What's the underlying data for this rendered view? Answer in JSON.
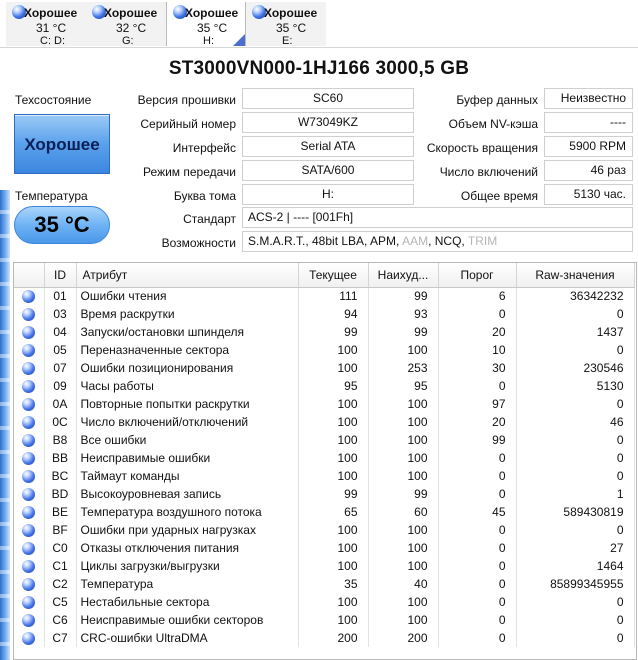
{
  "drives": [
    {
      "status": "Хорошее",
      "temp": "31 °C",
      "letters": "C: D:",
      "selected": false
    },
    {
      "status": "Хорошее",
      "temp": "32 °C",
      "letters": "G:",
      "selected": false
    },
    {
      "status": "Хорошее",
      "temp": "35 °C",
      "letters": "H:",
      "selected": true
    },
    {
      "status": "Хорошее",
      "temp": "35 °C",
      "letters": "E:",
      "selected": false
    }
  ],
  "model_title": "ST3000VN000-1HJ166  3000,5 GB",
  "health": {
    "label": "Техсостояние",
    "value": "Хорошее"
  },
  "temperature": {
    "label": "Температура",
    "value": "35 °C"
  },
  "info": {
    "firmware": {
      "label": "Версия прошивки",
      "value": "SC60"
    },
    "serial": {
      "label": "Серийный номер",
      "value": "W73049KZ"
    },
    "interface": {
      "label": "Интерфейс",
      "value": "Serial ATA"
    },
    "transfer": {
      "label": "Режим передачи",
      "value": "SATA/600"
    },
    "drive_letter": {
      "label": "Буква тома",
      "value": "H:"
    },
    "standard": {
      "label": "Стандарт",
      "value": "ACS-2 | ---- [001Fh]"
    },
    "features_label": "Возможности",
    "features_active": "S.M.A.R.T., 48bit LBA, APM, ",
    "features_aam": "AAM",
    "features_ncq": ", NCQ, ",
    "features_trim": "TRIM",
    "buffer": {
      "label": "Буфер данных",
      "value": "Неизвестно"
    },
    "nv_cache": {
      "label": "Объем NV-кэша",
      "value": "----"
    },
    "rotation": {
      "label": "Скорость вращения",
      "value": "5900 RPM"
    },
    "power_on_count": {
      "label": "Число включений",
      "value": "46 раз"
    },
    "power_on_hours": {
      "label": "Общее время",
      "value": "5130 час."
    }
  },
  "smart_columns": [
    "ID",
    "Атрибут",
    "Текущее",
    "Наихуд...",
    "Порог",
    "Raw-значения"
  ],
  "smart_rows": [
    {
      "id": "01",
      "name": "Ошибки чтения",
      "cur": "111",
      "worst": "99",
      "thr": "6",
      "raw": "36342232"
    },
    {
      "id": "03",
      "name": "Время раскрутки",
      "cur": "94",
      "worst": "93",
      "thr": "0",
      "raw": "0"
    },
    {
      "id": "04",
      "name": "Запуски/остановки шпинделя",
      "cur": "99",
      "worst": "99",
      "thr": "20",
      "raw": "1437"
    },
    {
      "id": "05",
      "name": "Переназначенные сектора",
      "cur": "100",
      "worst": "100",
      "thr": "10",
      "raw": "0"
    },
    {
      "id": "07",
      "name": "Ошибки позиционирования",
      "cur": "100",
      "worst": "253",
      "thr": "30",
      "raw": "230546"
    },
    {
      "id": "09",
      "name": "Часы работы",
      "cur": "95",
      "worst": "95",
      "thr": "0",
      "raw": "5130"
    },
    {
      "id": "0A",
      "name": "Повторные попытки раскрутки",
      "cur": "100",
      "worst": "100",
      "thr": "97",
      "raw": "0"
    },
    {
      "id": "0C",
      "name": "Число включений/отключений",
      "cur": "100",
      "worst": "100",
      "thr": "20",
      "raw": "46"
    },
    {
      "id": "B8",
      "name": "Все ошибки",
      "cur": "100",
      "worst": "100",
      "thr": "99",
      "raw": "0"
    },
    {
      "id": "BB",
      "name": "Неисправимые ошибки",
      "cur": "100",
      "worst": "100",
      "thr": "0",
      "raw": "0"
    },
    {
      "id": "BC",
      "name": "Таймаут команды",
      "cur": "100",
      "worst": "100",
      "thr": "0",
      "raw": "0"
    },
    {
      "id": "BD",
      "name": "Высокоуровневая запись",
      "cur": "99",
      "worst": "99",
      "thr": "0",
      "raw": "1"
    },
    {
      "id": "BE",
      "name": "Температура воздушного потока",
      "cur": "65",
      "worst": "60",
      "thr": "45",
      "raw": "589430819"
    },
    {
      "id": "BF",
      "name": "Ошибки при ударных нагрузках",
      "cur": "100",
      "worst": "100",
      "thr": "0",
      "raw": "0"
    },
    {
      "id": "C0",
      "name": "Отказы отключения питания",
      "cur": "100",
      "worst": "100",
      "thr": "0",
      "raw": "27"
    },
    {
      "id": "C1",
      "name": "Циклы загрузки/выгрузки",
      "cur": "100",
      "worst": "100",
      "thr": "0",
      "raw": "1464"
    },
    {
      "id": "C2",
      "name": "Температура",
      "cur": "35",
      "worst": "40",
      "thr": "0",
      "raw": "85899345955"
    },
    {
      "id": "C5",
      "name": "Нестабильные сектора",
      "cur": "100",
      "worst": "100",
      "thr": "0",
      "raw": "0"
    },
    {
      "id": "C6",
      "name": "Неисправимые ошибки секторов",
      "cur": "100",
      "worst": "100",
      "thr": "0",
      "raw": "0"
    },
    {
      "id": "C7",
      "name": "CRC-ошибки UltraDMA",
      "cur": "200",
      "worst": "200",
      "thr": "0",
      "raw": "0"
    }
  ],
  "colors": {
    "good_blue": "#3c86df",
    "accent": "#4a6fd0"
  },
  "icons": {
    "status_dot": "status-ball-icon"
  }
}
